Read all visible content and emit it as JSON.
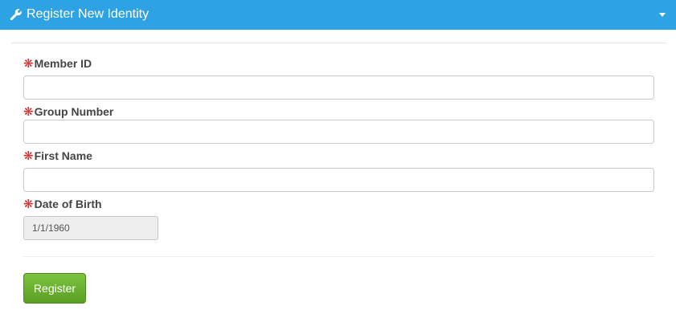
{
  "header": {
    "title": "Register New Identity",
    "icon": "wrench-icon"
  },
  "form": {
    "required_marker": "❋",
    "member_id": {
      "label": "Member ID",
      "value": ""
    },
    "group_number": {
      "label": "Group Number",
      "value": ""
    },
    "first_name": {
      "label": "First Name",
      "value": ""
    },
    "date_of_birth": {
      "label": "Date of Birth",
      "value": "1/1/1960"
    }
  },
  "actions": {
    "register_label": "Register"
  },
  "colors": {
    "header_bg": "#2ea3e3",
    "required_star": "#e21d1d",
    "button_green": "#6ab332"
  }
}
